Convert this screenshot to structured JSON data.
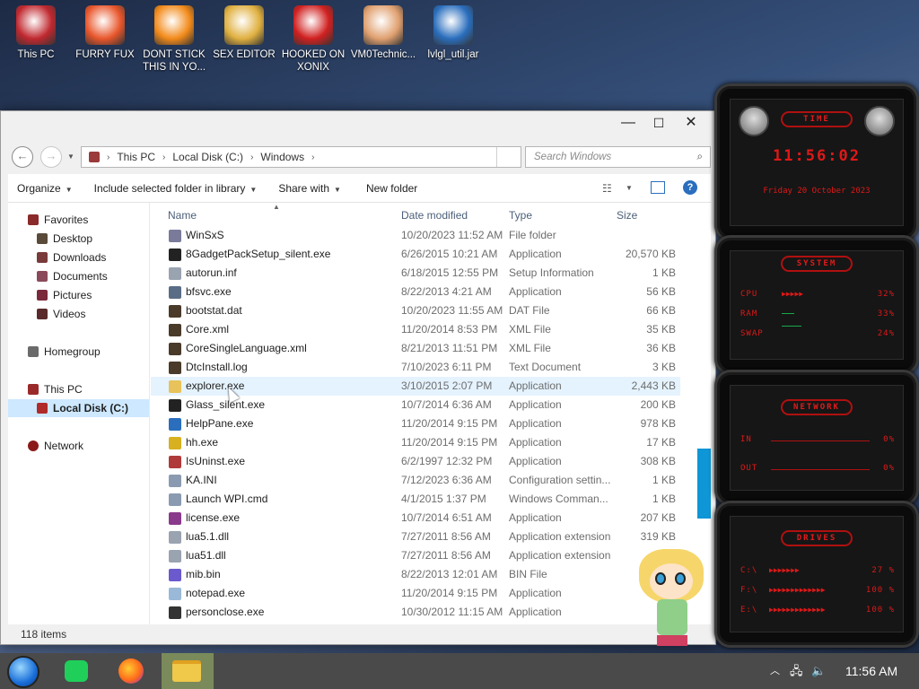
{
  "desktop": {
    "icons": [
      {
        "label": "This PC",
        "color": "#c0282f"
      },
      {
        "label": "FURRY FUX",
        "color": "#e8562b"
      },
      {
        "label": "DONT STICK THIS IN YO...",
        "color": "#f28a1a"
      },
      {
        "label": "SEX EDITOR",
        "color": "#e0b040"
      },
      {
        "label": "HOOKED ON XONIX",
        "color": "#d02020"
      },
      {
        "label": "VM0Technic...",
        "color": "#e0a070"
      },
      {
        "label": "lvlgl_util.jar",
        "color": "#2a6ebd"
      }
    ]
  },
  "window": {
    "title_controls": {
      "minimize": "—",
      "maximize": "☐",
      "close": "✕"
    },
    "breadcrumb": [
      "This PC",
      "Local Disk (C:)",
      "Windows"
    ],
    "search_placeholder": "Search Windows",
    "toolbar": {
      "organize": "Organize",
      "include": "Include selected folder in library",
      "share": "Share with",
      "new_folder": "New folder"
    },
    "nav": {
      "favorites": "Favorites",
      "desktop": "Desktop",
      "downloads": "Downloads",
      "documents": "Documents",
      "pictures": "Pictures",
      "videos": "Videos",
      "homegroup": "Homegroup",
      "this_pc": "This PC",
      "local_disk": "Local Disk (C:)",
      "network": "Network"
    },
    "columns": {
      "name": "Name",
      "date": "Date modified",
      "type": "Type",
      "size": "Size"
    },
    "files": [
      {
        "name": "WinSxS",
        "date": "10/20/2023 11:52 AM",
        "type": "File folder",
        "size": "",
        "color": "#7a7a9a"
      },
      {
        "name": "8GadgetPackSetup_silent.exe",
        "date": "6/26/2015 10:21 AM",
        "type": "Application",
        "size": "20,570 KB",
        "color": "#222222"
      },
      {
        "name": "autorun.inf",
        "date": "6/18/2015 12:55 PM",
        "type": "Setup Information",
        "size": "1 KB",
        "color": "#9aa3b0"
      },
      {
        "name": "bfsvc.exe",
        "date": "8/22/2013 4:21 AM",
        "type": "Application",
        "size": "56 KB",
        "color": "#5a6d86"
      },
      {
        "name": "bootstat.dat",
        "date": "10/20/2023 11:55 AM",
        "type": "DAT File",
        "size": "66 KB",
        "color": "#4a3a2a"
      },
      {
        "name": "Core.xml",
        "date": "11/20/2014 8:53 PM",
        "type": "XML File",
        "size": "35 KB",
        "color": "#4a3a2a"
      },
      {
        "name": "CoreSingleLanguage.xml",
        "date": "8/21/2013 11:51 PM",
        "type": "XML File",
        "size": "36 KB",
        "color": "#4a3a2a"
      },
      {
        "name": "DtcInstall.log",
        "date": "7/10/2023 6:11 PM",
        "type": "Text Document",
        "size": "3 KB",
        "color": "#4a3a2a"
      },
      {
        "name": "explorer.exe",
        "date": "3/10/2015 2:07 PM",
        "type": "Application",
        "size": "2,443 KB",
        "color": "#e8c25a"
      },
      {
        "name": "Glass_silent.exe",
        "date": "10/7/2014 6:36 AM",
        "type": "Application",
        "size": "200 KB",
        "color": "#222222"
      },
      {
        "name": "HelpPane.exe",
        "date": "11/20/2014 9:15 PM",
        "type": "Application",
        "size": "978 KB",
        "color": "#2a6ebd"
      },
      {
        "name": "hh.exe",
        "date": "11/20/2014 9:15 PM",
        "type": "Application",
        "size": "17 KB",
        "color": "#d8b020"
      },
      {
        "name": "IsUninst.exe",
        "date": "6/2/1997 12:32 PM",
        "type": "Application",
        "size": "308 KB",
        "color": "#b03a3a"
      },
      {
        "name": "KA.INI",
        "date": "7/12/2023 6:36 AM",
        "type": "Configuration settin...",
        "size": "1 KB",
        "color": "#8a9ab0"
      },
      {
        "name": "Launch WPI.cmd",
        "date": "4/1/2015 1:37 PM",
        "type": "Windows Comman...",
        "size": "1 KB",
        "color": "#8a9ab0"
      },
      {
        "name": "license.exe",
        "date": "10/7/2014 6:51 AM",
        "type": "Application",
        "size": "207 KB",
        "color": "#8a3a8a"
      },
      {
        "name": "lua5.1.dll",
        "date": "7/27/2011 8:56 AM",
        "type": "Application extension",
        "size": "319 KB",
        "color": "#9aa3b0"
      },
      {
        "name": "lua51.dll",
        "date": "7/27/2011 8:56 AM",
        "type": "Application extension",
        "size": "",
        "color": "#9aa3b0"
      },
      {
        "name": "mib.bin",
        "date": "8/22/2013 12:01 AM",
        "type": "BIN File",
        "size": "",
        "color": "#6a5acd"
      },
      {
        "name": "notepad.exe",
        "date": "11/20/2014 9:15 PM",
        "type": "Application",
        "size": "",
        "color": "#9ab8d8"
      },
      {
        "name": "personclose.exe",
        "date": "10/30/2012 11:15 AM",
        "type": "Application",
        "size": "",
        "color": "#333333"
      }
    ],
    "status": "118 items"
  },
  "gadgets": {
    "time": {
      "title": "TIME",
      "clock": "11:56:02",
      "date": "Friday 20 October 2023"
    },
    "system": {
      "title": "SYSTEM",
      "cpu_label": "CPU",
      "cpu": "32%",
      "ram_label": "RAM",
      "ram": "33%",
      "swap_label": "SWAP",
      "swap": "24%"
    },
    "network": {
      "title": "NETWORK",
      "in_label": "IN",
      "in": "0%",
      "out_label": "OUT",
      "out": "0%"
    },
    "drives": {
      "title": "DRIVES",
      "d1_label": "C:\\",
      "d1": "27 %",
      "d2_label": "F:\\",
      "d2": "100 %",
      "d3_label": "E:\\",
      "d3": "100 %"
    }
  },
  "taskbar": {
    "clock": "11:56 AM"
  }
}
